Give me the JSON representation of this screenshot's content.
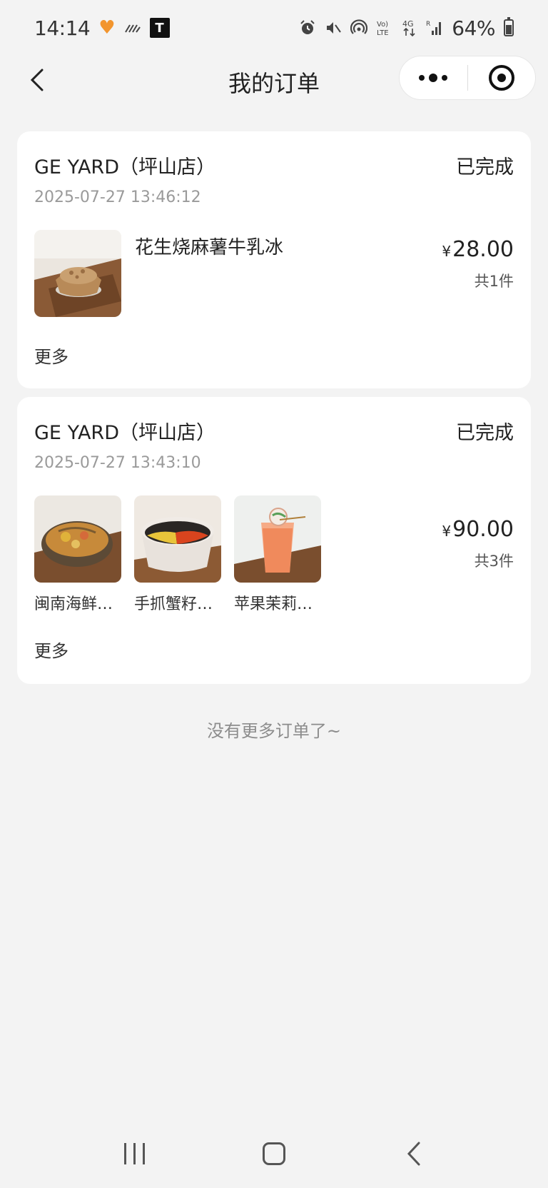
{
  "status_bar": {
    "time": "14:14",
    "battery": "64%",
    "icons": [
      "heart-app-icon",
      "activity-icon",
      "tesla-icon",
      "alarm-icon",
      "mute-icon",
      "hotspot-icon",
      "volte-icon",
      "4g-data-icon",
      "signal-icon",
      "battery-icon"
    ]
  },
  "nav": {
    "title": "我的订单"
  },
  "orders": [
    {
      "store": "GE YARD（坪山店）",
      "status": "已完成",
      "time": "2025-07-27 13:46:12",
      "items": [
        {
          "name": "花生烧麻薯牛乳冰",
          "image": "shaved-ice-dessert"
        }
      ],
      "currency": "¥",
      "amount": "28.00",
      "qty": "共1件",
      "more": "更多"
    },
    {
      "store": "GE YARD（坪山店）",
      "status": "已完成",
      "time": "2025-07-27 13:43:10",
      "items": [
        {
          "name": "闽南海鲜…",
          "image": "seafood-curry-bowl"
        },
        {
          "name": "手抓蟹籽…",
          "image": "crab-roe-rice-bowl"
        },
        {
          "name": "苹果茉莉…",
          "image": "apple-jasmine-drink"
        }
      ],
      "currency": "¥",
      "amount": "90.00",
      "qty": "共3件",
      "more": "更多"
    }
  ],
  "footer_tip": "没有更多订单了~",
  "colors": {
    "page_bg": "#f3f3f3",
    "card_bg": "#ffffff",
    "secondary_text": "#9a9a9a",
    "accent_orange": "#f2952e"
  }
}
